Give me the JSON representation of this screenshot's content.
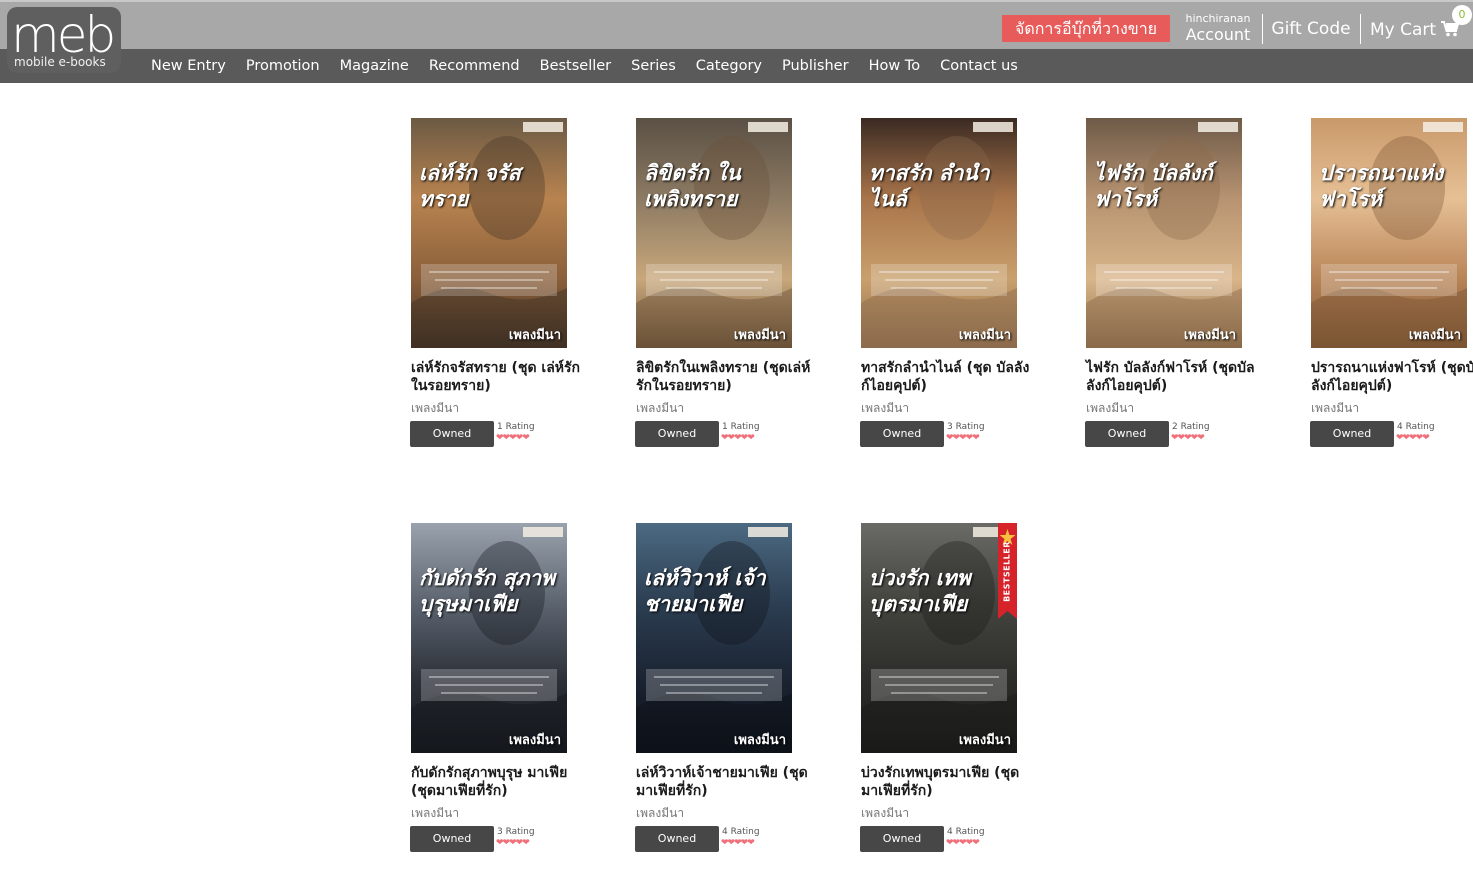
{
  "brand": {
    "logo_text": "meb",
    "tagline": "mobile e-books"
  },
  "header": {
    "manage_button": "จัดการอีบุ๊กที่วางขาย",
    "account_username": "hinchiranan",
    "account_label": "Account",
    "gift_code": "Gift Code",
    "cart_label": "My Cart",
    "cart_count": "0",
    "cart_icon": "shopping-cart-icon"
  },
  "nav": [
    {
      "label": "New Entry"
    },
    {
      "label": "Promotion"
    },
    {
      "label": "Magazine"
    },
    {
      "label": "Recommend"
    },
    {
      "label": "Bestseller"
    },
    {
      "label": "Series"
    },
    {
      "label": "Category"
    },
    {
      "label": "Publisher"
    },
    {
      "label": "How To"
    },
    {
      "label": "Contact us"
    }
  ],
  "colors": {
    "topbar": "#a8a8a8",
    "navbar": "#5a5a5a",
    "manage_button": "#e85b5b",
    "owned_button": "#474747",
    "heart": "#f0707a"
  },
  "books": [
    {
      "title": "เล่ห์รักจรัสทราย (ชุด เล่ห์รักในรอยทราย)",
      "author": "เพลงมีนา",
      "status": "Owned",
      "rating_text": "1 Rating",
      "rating": 5,
      "cover_title": "เล่ห์รัก จรัสทราย",
      "cover_author": "เพลงมีนา",
      "cover_colors": [
        "#6b5a44",
        "#b8834f",
        "#8a5f3a",
        "#3f3024"
      ],
      "bestseller": false
    },
    {
      "title": "ลิขิตรักในเพลิงทราย (ชุดเล่ห์รักในรอยทราย)",
      "author": "เพลงมีนา",
      "status": "Owned",
      "rating_text": "1 Rating",
      "rating": 5,
      "cover_title": "ลิขิตรัก ในเพลิงทราย",
      "cover_author": "เพลงมีนา",
      "cover_colors": [
        "#5a5044",
        "#8c7a63",
        "#c8a77b",
        "#6b5138"
      ],
      "bestseller": false
    },
    {
      "title": "ทาสรักลำนำไนล์ (ชุด บัลลังก์ไอยคุปต์)",
      "author": "เพลงมีนา",
      "status": "Owned",
      "rating_text": "3 Rating",
      "rating": 5,
      "cover_title": "ทาสรัก ลำนำไนล์",
      "cover_author": "เพลงมีนา",
      "cover_colors": [
        "#3a2a22",
        "#a8744a",
        "#c9a06c",
        "#8c6a4c"
      ],
      "bestseller": false
    },
    {
      "title": "ไฟรัก บัลลังก์ฟาโรห์ (ชุดบัลลังก์ไอยคุปต์)",
      "author": "เพลงมีนา",
      "status": "Owned",
      "rating_text": "2 Rating",
      "rating": 5,
      "cover_title": "ไฟรัก บัลลังก์ฟาโรห์",
      "cover_author": "เพลงมีนา",
      "cover_colors": [
        "#6e5a48",
        "#b79371",
        "#d9b58a",
        "#8a6a4a"
      ],
      "bestseller": false
    },
    {
      "title": "ปรารถนาแห่งฟาโรห์ (ชุดบัลลังก์ไอยคุปต์)",
      "author": "เพลงมีนา",
      "status": "Owned",
      "rating_text": "4 Rating",
      "rating": 5,
      "cover_title": "ปรารถนาแห่งฟาโรห์",
      "cover_author": "เพลงมีนา",
      "cover_colors": [
        "#c9996a",
        "#e6c095",
        "#b88457",
        "#7a5433"
      ],
      "bestseller": false
    },
    {
      "title": "กับดักรักสุภาพบุรุษ มาเฟีย (ชุดมาเฟียที่รัก)",
      "author": "เพลงมีนา",
      "status": "Owned",
      "rating_text": "3 Rating",
      "rating": 5,
      "cover_title": "กับดักรัก สุภาพบุรุษมาเฟีย",
      "cover_author": "เพลงมีนา",
      "cover_colors": [
        "#9aa2ad",
        "#5c6470",
        "#2a2e36",
        "#15181d"
      ],
      "bestseller": false
    },
    {
      "title": "เล่ห์วิวาห์เจ้าชายมาเฟีย (ชุดมาเฟียที่รัก)",
      "author": "เพลงมีนา",
      "status": "Owned",
      "rating_text": "4 Rating",
      "rating": 5,
      "cover_title": "เล่ห์วิวาห์ เจ้าชายมาเฟีย",
      "cover_author": "เพลงมีนา",
      "cover_colors": [
        "#4c6a82",
        "#2c3e52",
        "#1a2230",
        "#0d1118"
      ],
      "bestseller": false
    },
    {
      "title": "บ่วงรักเทพบุตรมาเฟีย (ชุดมาเฟียที่รัก)",
      "author": "เพลงมีนา",
      "status": "Owned",
      "rating_text": "4 Rating",
      "rating": 5,
      "cover_title": "บ่วงรัก เทพบุตรมาเฟีย",
      "cover_author": "เพลงมีนา",
      "cover_colors": [
        "#6a6a66",
        "#44443f",
        "#2b2b28",
        "#1a1a18"
      ],
      "bestseller": true,
      "badge": "BESTSELLER"
    }
  ]
}
